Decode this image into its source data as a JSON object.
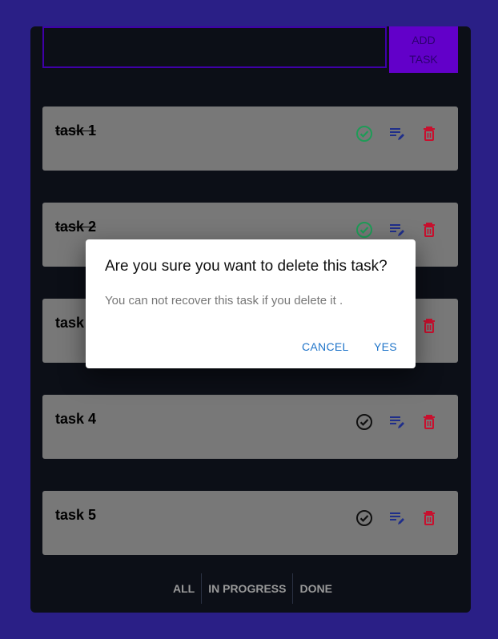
{
  "input": {
    "value": "",
    "placeholder": ""
  },
  "add_button": {
    "line1": "ADD",
    "line2": "TASK"
  },
  "tasks": [
    {
      "title": "task 1",
      "done": true
    },
    {
      "title": "task 2",
      "done": true
    },
    {
      "title": "task 3",
      "done": false
    },
    {
      "title": "task 4",
      "done": false
    },
    {
      "title": "task 5",
      "done": false
    }
  ],
  "icons": {
    "done": "check-circle-icon",
    "edit": "edit-list-icon",
    "delete": "trash-icon"
  },
  "colors": {
    "done_check": "#1f9b57",
    "pending_check": "#111111",
    "edit": "#1f2e8a",
    "delete": "#c8102e",
    "accent": "#6200c9"
  },
  "filters": [
    "ALL",
    "IN PROGRESS",
    "DONE"
  ],
  "dialog": {
    "title": "Are you sure you want to delete this task?",
    "body": "You can not recover this task if you delete it .",
    "cancel_label": "CANCEL",
    "confirm_label": "YES"
  }
}
